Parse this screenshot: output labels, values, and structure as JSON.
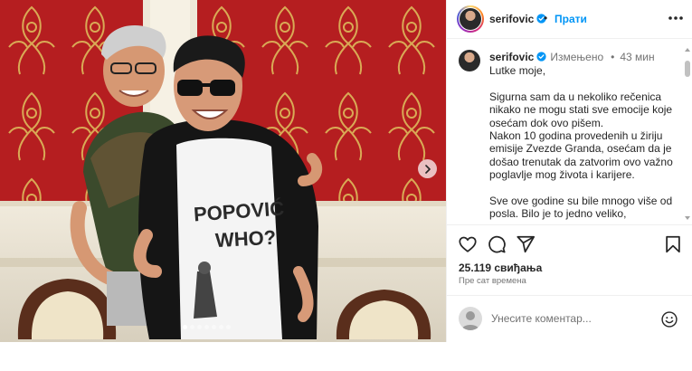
{
  "header": {
    "username": "serifovic",
    "separator": "•",
    "follow_label": "Прати",
    "more_icon": "more-horizontal-icon"
  },
  "caption": {
    "username": "serifovic",
    "edited_label": "Измењено",
    "time_dot": "•",
    "time": "43 мин",
    "lines": [
      "Lutke moje,",
      "",
      "Sigurna sam da u nekoliko rečenica nikako ne mogu stati sve emocije koje osećam dok ovo pišem.",
      "Nakon 10 godina provedenih u žiriju emisije Zvezde Granda, osećam da je došao trenutak da zatvorim ovo važno poglavlje mog života i karijere.",
      "",
      "Sve ove godine su bile mnogo više od posla. Bilo je to jedno veliko,"
    ]
  },
  "media": {
    "shirt_text_line1": "POPOVIĆ",
    "shirt_text_line2": "WHO?",
    "carousel_dots": 7,
    "active_dot": 0,
    "next_icon": "chevron-right-icon"
  },
  "actions": {
    "like_icon": "heart-icon",
    "comment_icon": "comment-icon",
    "share_icon": "send-icon",
    "save_icon": "bookmark-icon"
  },
  "likes": "25.119 свиђања",
  "time_ago": "Пре сат времена",
  "comment": {
    "placeholder": "Унесите коментар...",
    "emoji_icon": "emoji-icon"
  },
  "colors": {
    "accent": "#0095f6",
    "verified": "#0095f6",
    "muted": "#737373",
    "wallpaper": "#b31b1b",
    "gold": "#d7a94b"
  }
}
